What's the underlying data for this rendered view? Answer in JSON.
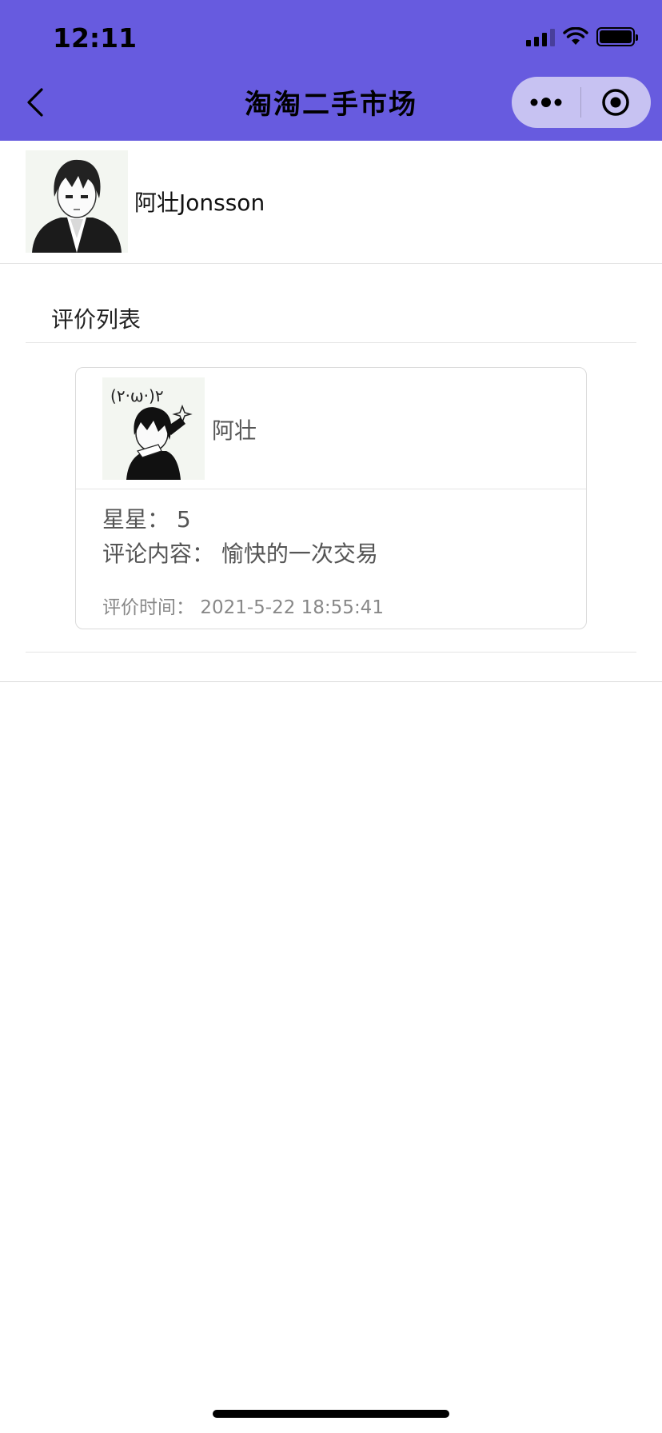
{
  "status_bar": {
    "time": "12:11"
  },
  "nav": {
    "title": "淘淘二手市场"
  },
  "profile": {
    "name": "阿壮Jonsson"
  },
  "reviews_section": {
    "title": "评价列表"
  },
  "reviews": [
    {
      "name": "阿壮",
      "stars_label": "星星：",
      "stars": "5",
      "comment_label": "评论内容：",
      "comment": "愉快的一次交易",
      "time_label": "评价时间：",
      "time": "2021-5-22 18:55:41"
    }
  ],
  "colors": {
    "nav_bg": "#675bdf",
    "capsule_bg": "#c7c2f2"
  },
  "icons": [
    "back-chevron-icon",
    "more-dots-icon",
    "close-target-icon",
    "signal-icon",
    "wifi-icon",
    "battery-icon"
  ]
}
